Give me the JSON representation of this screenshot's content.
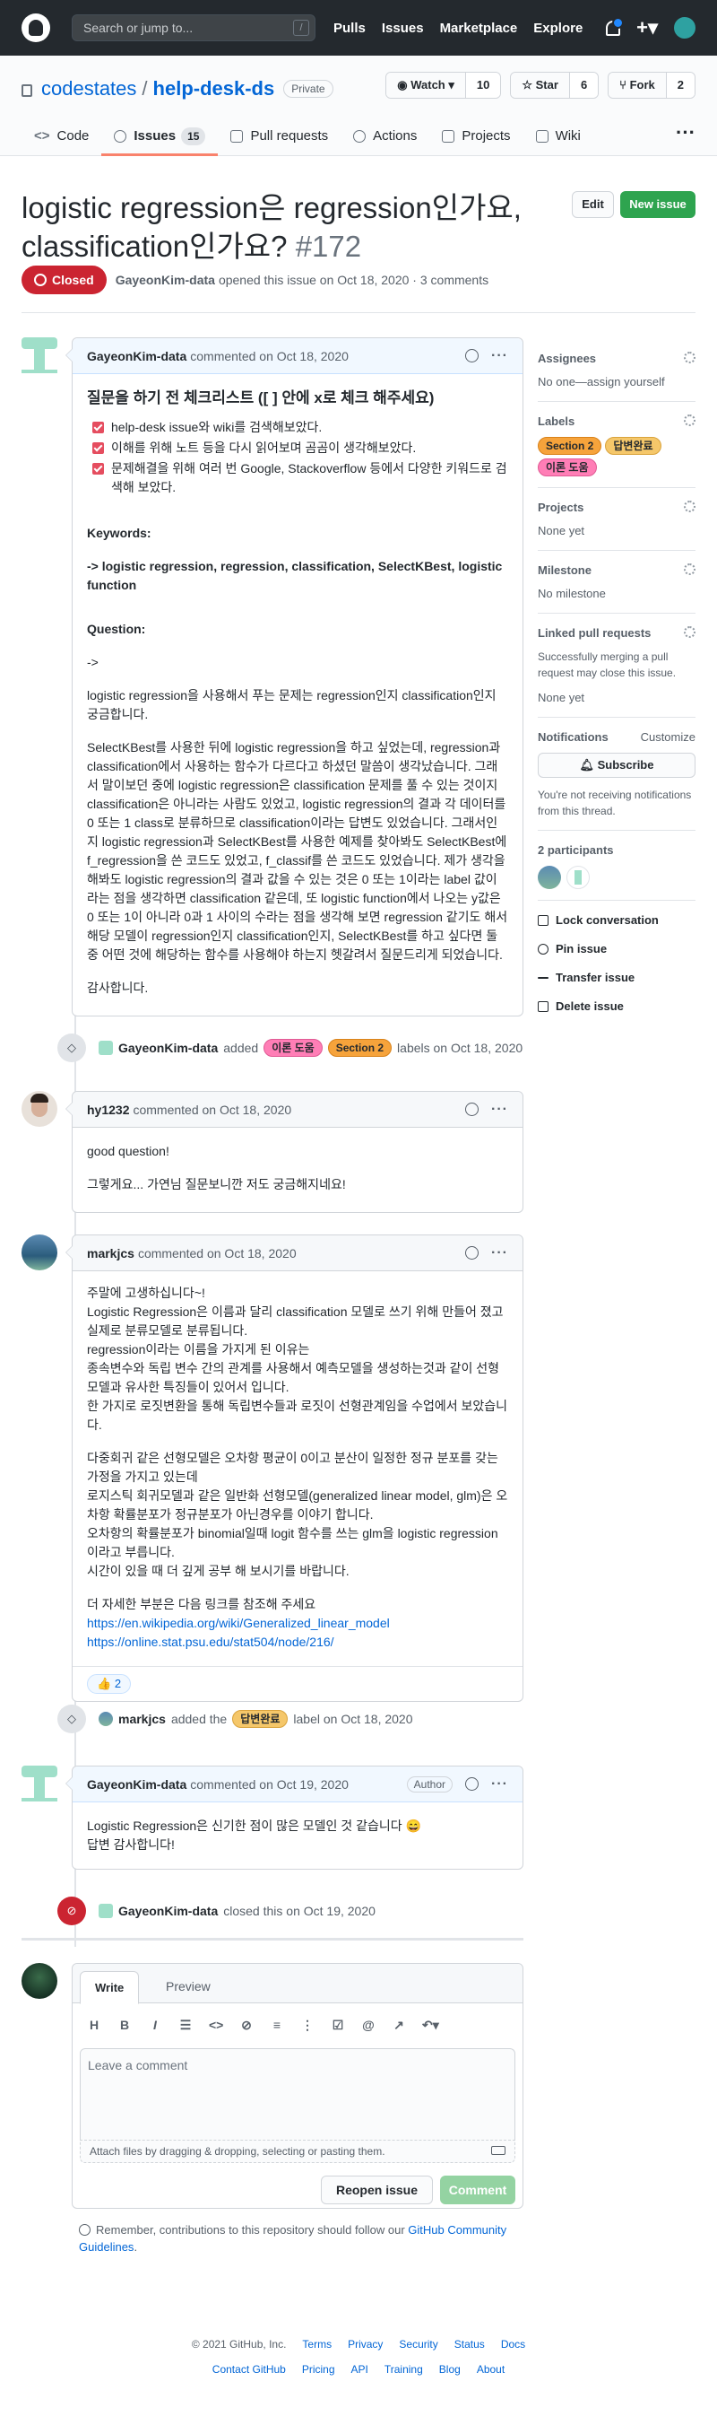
{
  "header": {
    "search_placeholder": "Search or jump to...",
    "search_key": "/",
    "nav": [
      "Pulls",
      "Issues",
      "Marketplace",
      "Explore"
    ]
  },
  "repo": {
    "owner": "codestates",
    "sep": "/",
    "name": "help-desk-ds",
    "visibility": "Private",
    "watch": {
      "label": "Watch",
      "count": "10"
    },
    "star": {
      "label": "Star",
      "count": "6"
    },
    "fork": {
      "label": "Fork",
      "count": "2"
    },
    "tabs": [
      {
        "label": "Code"
      },
      {
        "label": "Issues",
        "count": "15"
      },
      {
        "label": "Pull requests"
      },
      {
        "label": "Actions"
      },
      {
        "label": "Projects"
      },
      {
        "label": "Wiki"
      }
    ]
  },
  "issue": {
    "title": "logistic regression은 regression인가요, classification인가요?",
    "number": "#172",
    "edit": "Edit",
    "new_issue": "New issue",
    "state": "Closed",
    "author": "GayeonKim-data",
    "meta": "opened this issue on Oct 18, 2020 · 3 comments"
  },
  "comments": [
    {
      "author": "GayeonKim-data",
      "meta": "commented on Oct 18, 2020",
      "heading": "질문을 하기 전 체크리스트 ([ ] 안에 x로 체크 해주세요)",
      "checklist": [
        "help-desk issue와 wiki를 검색해보았다.",
        "이해를 위해 노트 등을 다시 읽어보며 곰곰이 생각해보았다.",
        "문제해결을 위해 여러 번 Google, Stackoverflow 등에서 다양한 키워드로 검색해 보았다."
      ],
      "kw_label": "Keywords:",
      "keywords": "-> logistic regression, regression, classification, SelectKBest, logistic function",
      "q_label": "Question:",
      "arrow": "->",
      "p1": "logistic regression을 사용해서 푸는 문제는 regression인지 classification인지 궁금합니다.",
      "p2": "SelectKBest를 사용한 뒤에 logistic regression을 하고 싶었는데, regression과 classification에서 사용하는 함수가 다르다고 하셨던 말씀이 생각났습니다. 그래서 말이보던 중에 logistic regression은 classification 문제를 풀 수 있는 것이지 classification은 아니라는 사람도 있었고, logistic regression의 결과 각 데이터를 0 또는 1 class로 분류하므로 classification이라는 답변도 있었습니다. 그래서인지 logistic regression과 SelectKBest를 사용한 예제를 찾아봐도 SelectKBest에 f_regression을 쓴 코드도 있었고, f_classif를 쓴 코드도 있었습니다. 제가 생각을 해봐도 logistic regression의 결과 값을 수 있는 것은 0 또는 1이라는 label 값이라는 점을 생각하면 classification 같은데, 또 logistic function에서 나오는 y값은 0 또는 1이 아니라 0과 1 사이의 수라는 점을 생각해 보면 regression 같기도 해서 해당 모델이 regression인지 classification인지, SelectKBest를 하고 싶다면 둘 중 어떤 것에 해당하는 함수를 사용해야 하는지 헷갈려서 질문드리게 되었습니다.",
      "p3": "감사합니다."
    },
    {
      "author": "hy1232",
      "meta": "commented on Oct 18, 2020",
      "p1": "good question!",
      "p2": "그렇게요... 가연님 질문보니깐 저도 궁금해지네요!"
    },
    {
      "author": "markjcs",
      "meta": "commented on Oct 18, 2020",
      "lines1": [
        "주말에 고생하십니다~!",
        "Logistic Regression은 이름과 달리 classification 모델로 쓰기 위해 만들어 졌고 실제로 분류모델로 분류됩니다.",
        "regression이라는 이름을 가지게 된 이유는",
        "종속변수와 독립 변수 간의 관계를 사용해서 예측모델을 생성하는것과 같이 선형모델과 유사한 특징들이 있어서 입니다.",
        "한 가지로 로짓변환을 통해 독립변수들과 로짓이 선형관계임을 수업에서 보았습니다."
      ],
      "lines2": [
        "다중회귀 같은 선형모델은 오차항 평균이 0이고 분산이 일정한 정규 분포를 갖는 가정을 가지고 있는데",
        "로지스틱 회귀모델과 같은 일반화 선형모델(generalized linear model, glm)은 오차항 확률분포가 정규분포가 아닌경우를 이야기 합니다.",
        "오차항의 확률분포가 binomial일때 logit 함수를 쓰는 glm을 logistic regression 이라고 부릅니다.",
        "시간이 있을 때 더 깊게 공부 해 보시기를 바랍니다."
      ],
      "ref": "더 자세한 부분은 다음 링크를 참조해 주세요",
      "link1": "https://en.wikipedia.org/wiki/Generalized_linear_model",
      "link2": "https://online.stat.psu.edu/stat504/node/216/",
      "reaction": "👍",
      "reaction_count": "2"
    },
    {
      "author": "GayeonKim-data",
      "meta": "commented on Oct 19, 2020",
      "role": "Author",
      "p1": "Logistic Regression은 신기한 점이 많은 모델인 것 같습니다 😄",
      "p2": "답변 감사합니다!"
    }
  ],
  "events": [
    {
      "actor": "GayeonKim-data",
      "pre": "added",
      "labels": [
        "이론 도움",
        "Section 2"
      ],
      "post": "labels on Oct 18, 2020"
    },
    {
      "actor": "markjcs",
      "pre": "added the",
      "labels": [
        "답변완료"
      ],
      "post": "label on Oct 18, 2020"
    },
    {
      "actor": "GayeonKim-data",
      "pre": "closed this on Oct 19, 2020"
    }
  ],
  "sidebar": {
    "assignees": {
      "title": "Assignees",
      "value": "No one—assign yourself"
    },
    "labels": {
      "title": "Labels",
      "items": [
        "Section 2",
        "답변완료",
        "이론 도움"
      ]
    },
    "projects": {
      "title": "Projects",
      "value": "None yet"
    },
    "milestone": {
      "title": "Milestone",
      "value": "No milestone"
    },
    "linked": {
      "title": "Linked pull requests",
      "desc": "Successfully merging a pull request may close this issue.",
      "value": "None yet"
    },
    "notifications": {
      "title": "Notifications",
      "customize": "Customize",
      "subscribe": "Subscribe",
      "desc": "You're not receiving notifications from this thread."
    },
    "participants": {
      "title": "2 participants"
    },
    "actions": [
      "Lock conversation",
      "Pin issue",
      "Transfer issue",
      "Delete issue"
    ]
  },
  "form": {
    "tab_write": "Write",
    "tab_preview": "Preview",
    "placeholder": "Leave a comment",
    "attach": "Attach files by dragging & dropping, selecting or pasting them.",
    "reopen": "Reopen issue",
    "comment": "Comment"
  },
  "reminder": {
    "text": "Remember, contributions to this repository should follow our",
    "link": "GitHub Community Guidelines",
    "end": "."
  },
  "footer": {
    "copy": "© 2021 GitHub, Inc.",
    "row1": [
      "Terms",
      "Privacy",
      "Security",
      "Status",
      "Docs"
    ],
    "row2": [
      "Contact GitHub",
      "Pricing",
      "API",
      "Training",
      "Blog",
      "About"
    ]
  },
  "colors": {
    "header": "#24292e",
    "closed": "#cb2431",
    "green": "#2ea44f",
    "link": "#0366d6"
  }
}
